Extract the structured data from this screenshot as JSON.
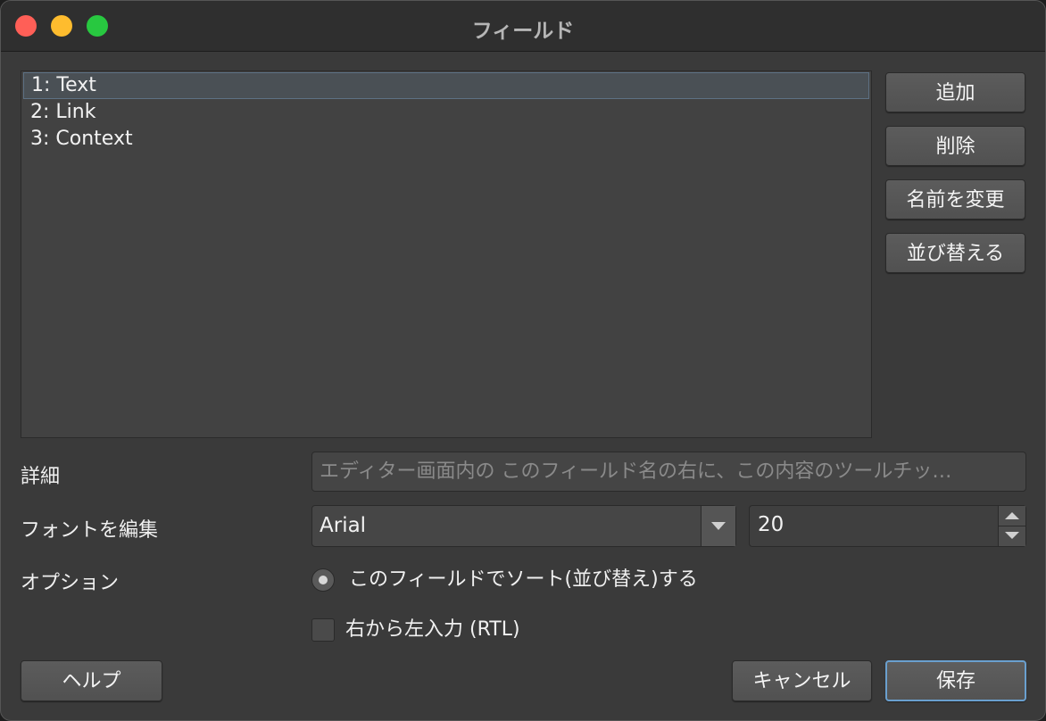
{
  "window": {
    "title": "フィールド"
  },
  "fields": {
    "items": [
      {
        "label": "1: Text",
        "selected": true
      },
      {
        "label": "2: Link",
        "selected": false
      },
      {
        "label": "3: Context",
        "selected": false
      }
    ]
  },
  "side_buttons": {
    "add": "追加",
    "delete": "削除",
    "rename": "名前を変更",
    "reorder": "並び替える"
  },
  "form": {
    "description_label": "詳細",
    "description_placeholder": "エディター画面内の このフィールド名の右に、この内容のツールチッ…",
    "font_label": "フォントを編集",
    "font_value": "Arial",
    "size_value": "20",
    "options_label": "オプション",
    "sort_option": "このフィールドでソート(並び替え)する",
    "sort_selected": true,
    "rtl_option": "右から左入力 (RTL)",
    "rtl_checked": false
  },
  "footer": {
    "help": "ヘルプ",
    "cancel": "キャンセル",
    "save": "保存"
  },
  "colors": {
    "window_bg": "#3a3a3a",
    "titlebar_bg": "#2f2f2f",
    "close": "#ff5f57",
    "minimize": "#febc2e",
    "zoom": "#28c840",
    "focus_ring": "#6aa0cf"
  }
}
